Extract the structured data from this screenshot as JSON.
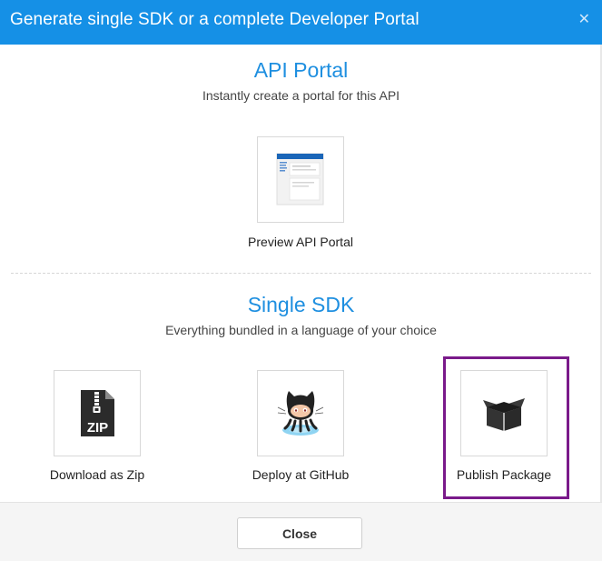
{
  "dialog": {
    "title": "Generate single SDK or a complete Developer Portal",
    "close_icon": "close-icon"
  },
  "api_portal": {
    "title": "API Portal",
    "subtitle": "Instantly create a portal for this API",
    "tiles": [
      {
        "label": "Preview API Portal",
        "icon": "portal-preview-icon"
      }
    ]
  },
  "single_sdk": {
    "title": "Single SDK",
    "subtitle": "Everything bundled in a language of your choice",
    "tiles": [
      {
        "label": "Download as Zip",
        "icon": "zip-file-icon",
        "icon_text": "ZIP"
      },
      {
        "label": "Deploy at GitHub",
        "icon": "github-octocat-icon"
      },
      {
        "label": "Publish Package",
        "icon": "package-box-icon",
        "highlighted": true
      }
    ]
  },
  "footer": {
    "close_label": "Close"
  },
  "colors": {
    "header": "#1590e6",
    "section_title": "#1e8fe0",
    "highlight_border": "#7a1a8a"
  }
}
